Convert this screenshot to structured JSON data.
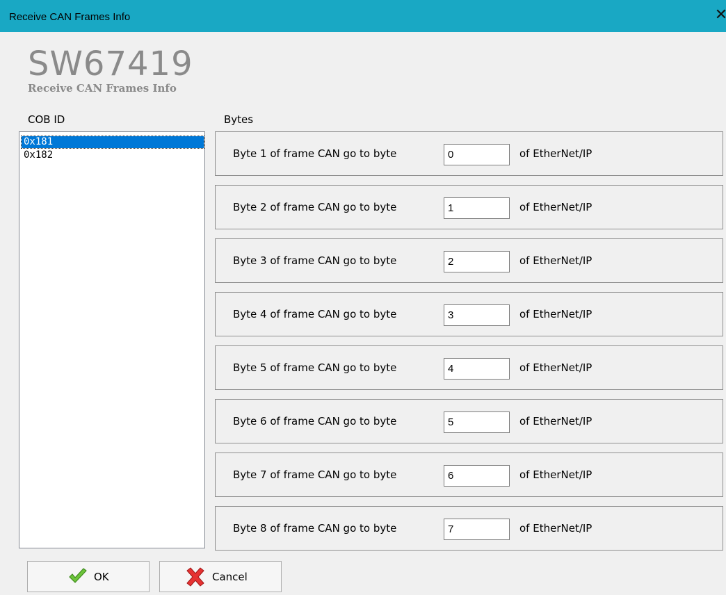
{
  "window": {
    "title": "Receive CAN Frames Info",
    "close_icon": "close-icon"
  },
  "header": {
    "app_name": "SW67419",
    "subtitle": "Receive CAN Frames Info"
  },
  "cob": {
    "label": "COB ID",
    "items": [
      "0x181",
      "0x182"
    ],
    "selected": "0x181"
  },
  "bytes": {
    "label": "Bytes",
    "rows": [
      {
        "label": "Byte 1 of frame CAN go to byte",
        "value": "0",
        "suffix": "of EtherNet/IP"
      },
      {
        "label": "Byte 2 of frame CAN go to byte",
        "value": "1",
        "suffix": "of EtherNet/IP"
      },
      {
        "label": "Byte 3 of frame CAN go to byte",
        "value": "2",
        "suffix": "of EtherNet/IP"
      },
      {
        "label": "Byte 4 of frame CAN go to byte",
        "value": "3",
        "suffix": "of EtherNet/IP"
      },
      {
        "label": "Byte 5 of frame CAN go to byte",
        "value": "4",
        "suffix": "of EtherNet/IP"
      },
      {
        "label": "Byte 6 of frame CAN go to byte",
        "value": "5",
        "suffix": "of EtherNet/IP"
      },
      {
        "label": "Byte 7 of frame CAN go to byte",
        "value": "6",
        "suffix": "of EtherNet/IP"
      },
      {
        "label": "Byte 8 of frame CAN go to byte",
        "value": "7",
        "suffix": "of EtherNet/IP"
      }
    ]
  },
  "buttons": {
    "ok_label": "OK",
    "cancel_label": "Cancel",
    "ok_icon": "checkmark-icon",
    "cancel_icon": "cross-icon"
  },
  "colors": {
    "titlebar": "#19a8c4",
    "selection": "#0078d7",
    "ok_green": "#5cb82e",
    "cancel_red": "#e02424"
  }
}
